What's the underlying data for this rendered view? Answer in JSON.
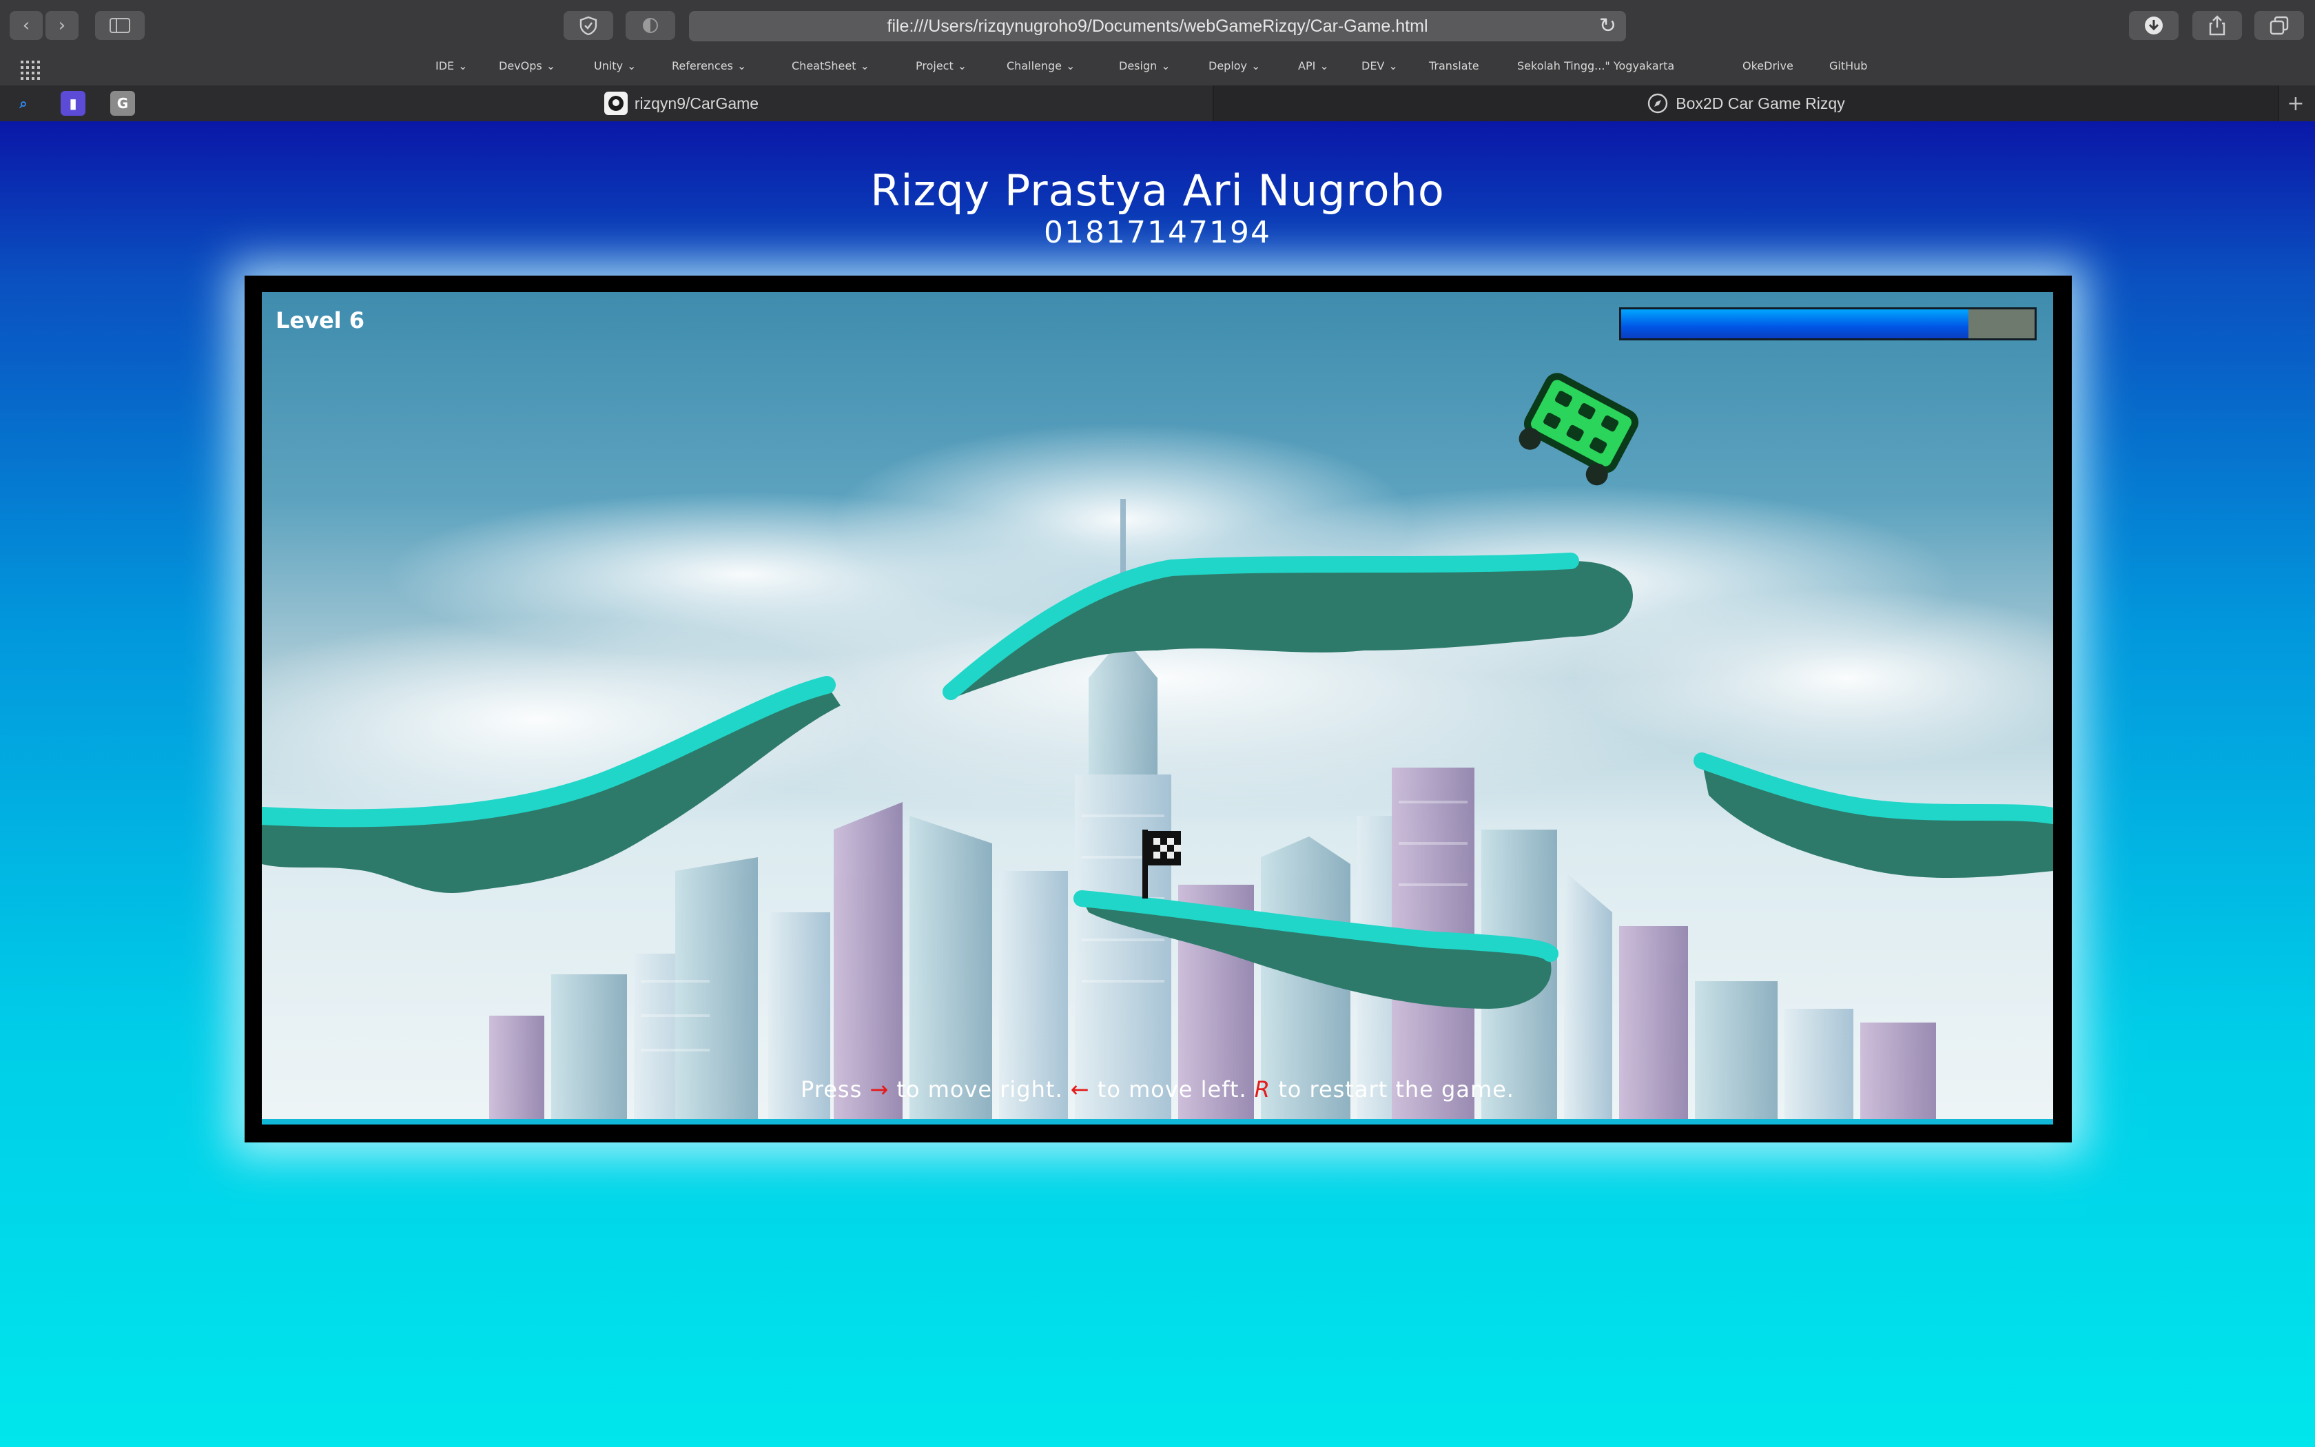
{
  "browser": {
    "url": "file:///Users/rizqynugroho9/Documents/webGameRizqy/Car-Game.html",
    "bookmarks": [
      {
        "label": "IDE",
        "menu": true
      },
      {
        "label": "DevOps",
        "menu": true
      },
      {
        "label": "Unity",
        "menu": true
      },
      {
        "label": "References",
        "menu": true
      },
      {
        "label": "CheatSheet",
        "menu": true
      },
      {
        "label": "Project",
        "menu": true
      },
      {
        "label": "Challenge",
        "menu": true
      },
      {
        "label": "Design",
        "menu": true
      },
      {
        "label": "Deploy",
        "menu": true
      },
      {
        "label": "API",
        "menu": true
      },
      {
        "label": "DEV",
        "menu": true
      },
      {
        "label": "Translate",
        "menu": false
      },
      {
        "label": "Sekolah Tingg...\" Yogyakarta",
        "menu": false
      },
      {
        "label": "OkeDrive",
        "menu": false
      },
      {
        "label": "GitHub",
        "menu": false
      }
    ],
    "tabs": [
      {
        "label": "rizqyn9/CarGame",
        "icon": "github-icon"
      },
      {
        "label": "Box2D Car Game Rizqy",
        "icon": "compass-icon"
      }
    ]
  },
  "page": {
    "title": "Rizqy Prastya Ari Nugroho",
    "subtitle": "01817147194"
  },
  "game": {
    "level_label": "Level 6",
    "health_fraction": 0.84,
    "instructions": {
      "press": "Press",
      "right_key": "→",
      "right_text": "to move right.",
      "left_key": "←",
      "left_text": "to move left.",
      "restart_key": "R",
      "restart_text": "to restart the game."
    }
  },
  "colors": {
    "health_bar": "#0a6cf0",
    "platform_top": "#1fd6c8",
    "platform_body": "#2e7a6a",
    "car": "#2bd45a",
    "key_highlight": "#e41b1b"
  }
}
